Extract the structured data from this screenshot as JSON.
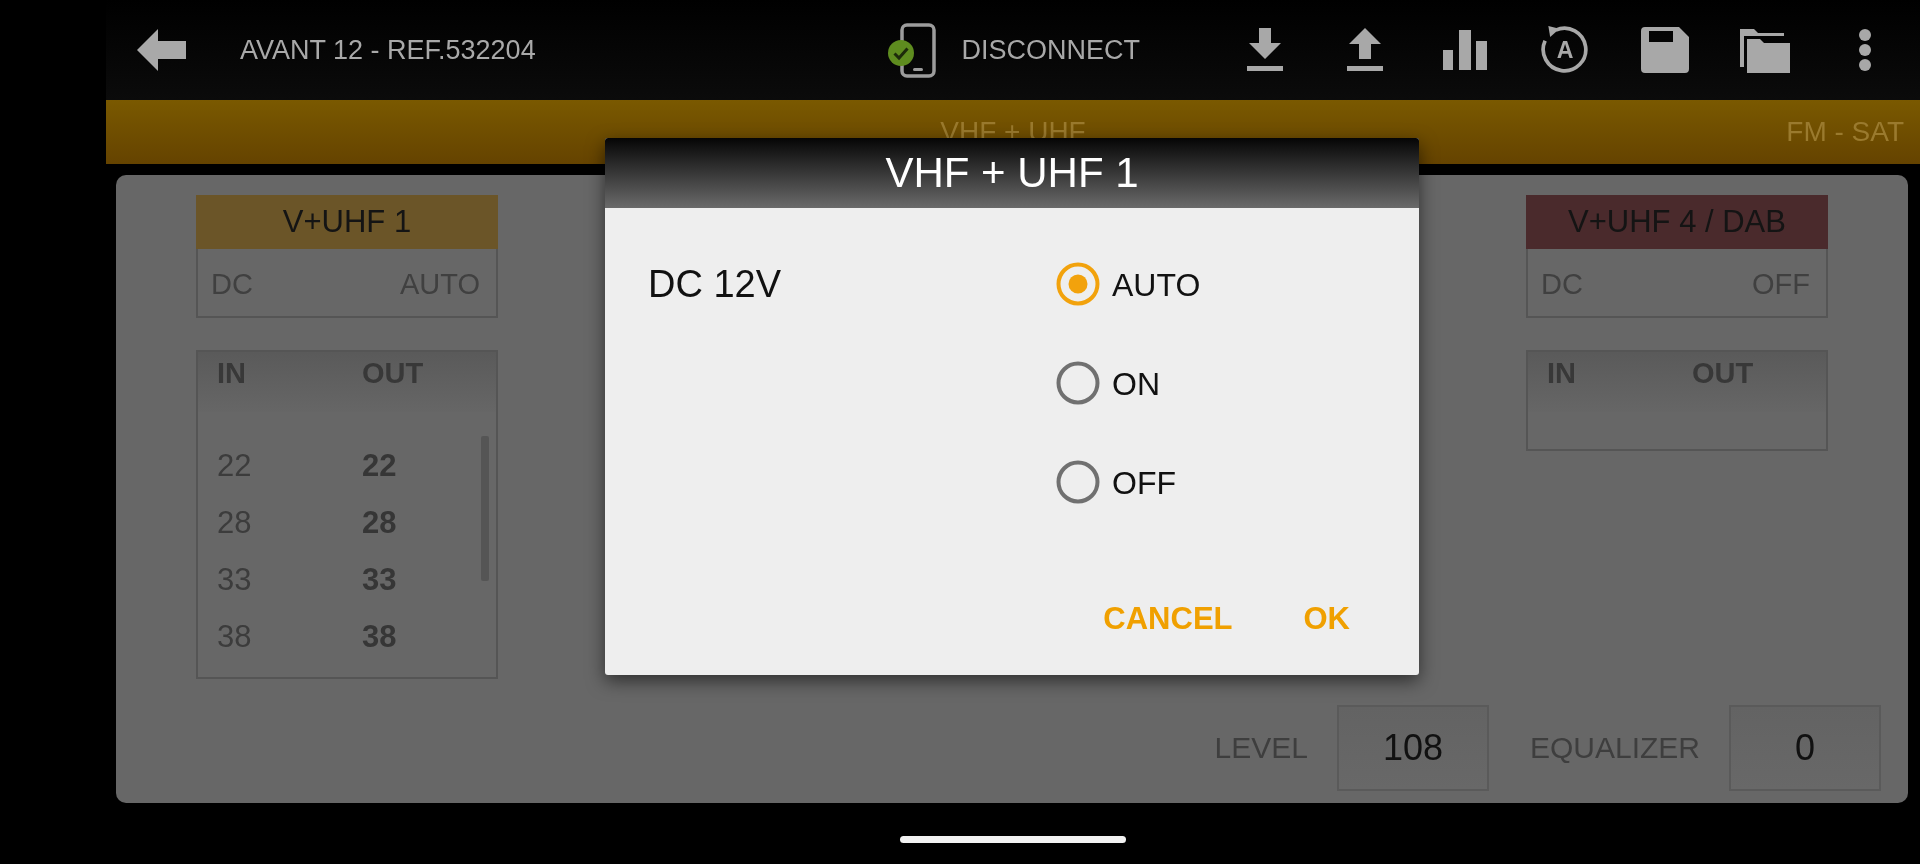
{
  "top_bar": {
    "title": "AVANT 12 - REF.532204",
    "connection": {
      "connected": true,
      "action": "DISCONNECT"
    },
    "rotate_icon_letter": "A"
  },
  "band_bar": {
    "current": "VHF + UHF",
    "next": "FM - SAT"
  },
  "outputs": [
    {
      "name": "V+UHF 1",
      "color": "#6b5528",
      "dc_label": "DC",
      "dc_mode": "AUTO",
      "columns": [
        "IN",
        "OUT"
      ],
      "channels": [
        {
          "in": "22",
          "out": "22"
        },
        {
          "in": "28",
          "out": "28"
        },
        {
          "in": "33",
          "out": "33"
        },
        {
          "in": "38",
          "out": "38"
        }
      ]
    },
    {
      "name": "V+UHF 4 / DAB",
      "color": "#4a2a2c",
      "dc_label": "DC",
      "dc_mode": "OFF",
      "columns": [
        "IN",
        "OUT"
      ]
    }
  ],
  "footer": {
    "fields": [
      {
        "label": "LEVEL",
        "value": "108"
      },
      {
        "label": "EQUALIZER",
        "value": "0"
      }
    ]
  },
  "dialog": {
    "title": "VHF + UHF 1",
    "setting": "DC 12V",
    "options": [
      {
        "label": "AUTO",
        "selected": true
      },
      {
        "label": "ON",
        "selected": false
      },
      {
        "label": "OFF",
        "selected": false
      }
    ],
    "buttons": [
      "CANCEL",
      "OK"
    ]
  }
}
